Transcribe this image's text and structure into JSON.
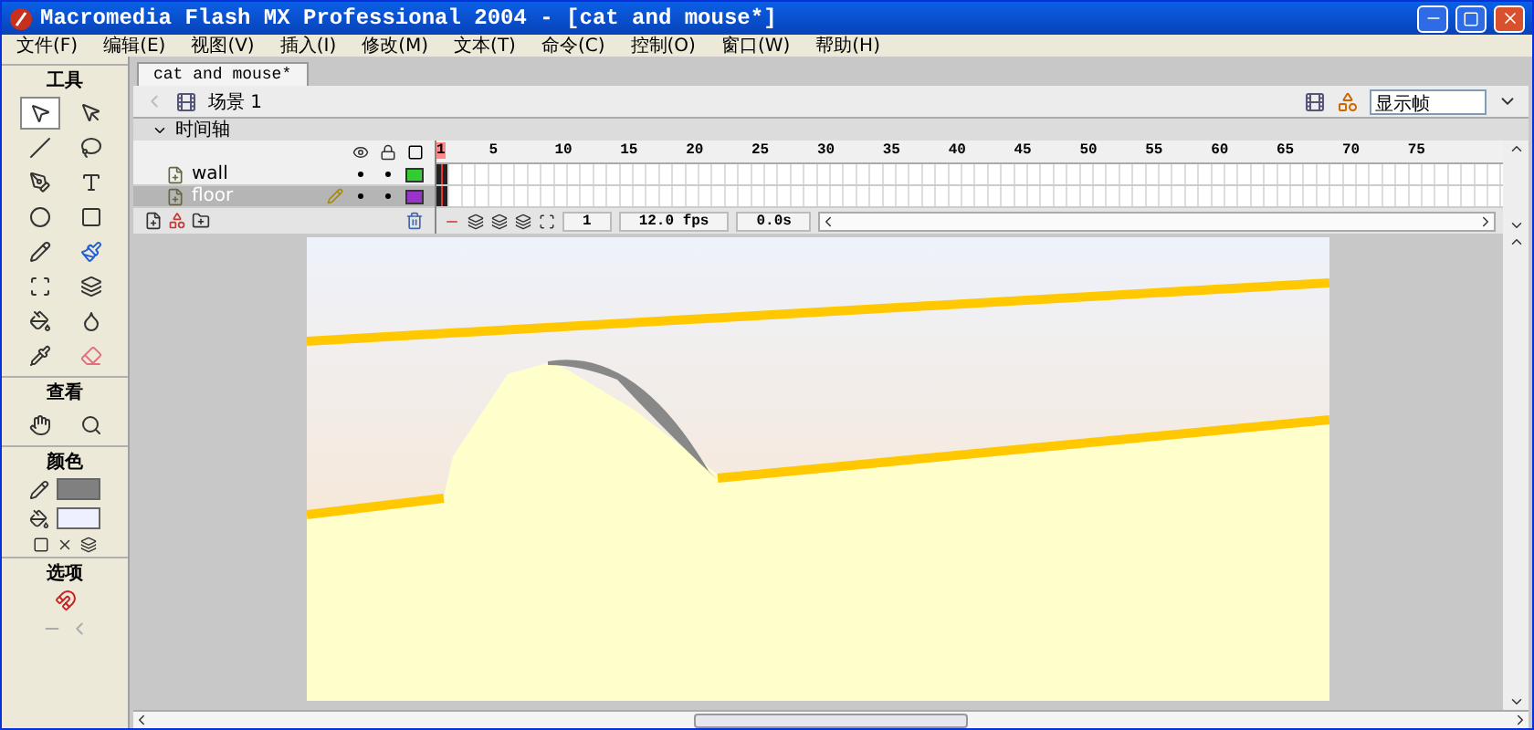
{
  "window": {
    "title": "Macromedia Flash MX Professional 2004 - [cat and mouse*]"
  },
  "menu": [
    "文件(F)",
    "编辑(E)",
    "视图(V)",
    "插入(I)",
    "修改(M)",
    "文本(T)",
    "命令(C)",
    "控制(O)",
    "窗口(W)",
    "帮助(H)"
  ],
  "toolbox": {
    "sections": [
      {
        "label": "工具",
        "tools": [
          {
            "selected": true
          },
          {
            "selected": false
          },
          {
            "selected": false
          },
          {
            "selected": false
          },
          {
            "selected": false
          },
          {
            "selected": false
          },
          {
            "selected": false
          },
          {
            "selected": false
          },
          {
            "selected": false
          },
          {
            "selected": false
          },
          {
            "selected": false
          },
          {
            "selected": false
          },
          {
            "selected": false
          },
          {
            "selected": false
          },
          {
            "selected": false
          },
          {
            "selected": false
          }
        ]
      },
      {
        "label": "查看",
        "tools": [
          {
            "selected": false
          },
          {
            "selected": false
          }
        ]
      },
      {
        "label": "颜色"
      },
      {
        "label": "选项"
      }
    ]
  },
  "document": {
    "tab": "cat and mouse*",
    "scene": "场景 1",
    "view_select": "显示帧"
  },
  "timeline": {
    "title": "时间轴",
    "ruler": [
      "1",
      "5",
      "10",
      "15",
      "20",
      "25",
      "30",
      "35",
      "40",
      "45",
      "50",
      "55",
      "60",
      "65",
      "70",
      "75"
    ],
    "layers": [
      {
        "name": "wall",
        "selected": false,
        "editing": false,
        "color": "#33cc33"
      },
      {
        "name": "floor",
        "selected": true,
        "editing": true,
        "color": "#9933cc"
      }
    ],
    "current_frame": "1",
    "frame_rate": "12.0 fps",
    "elapsed": "0.0s"
  }
}
